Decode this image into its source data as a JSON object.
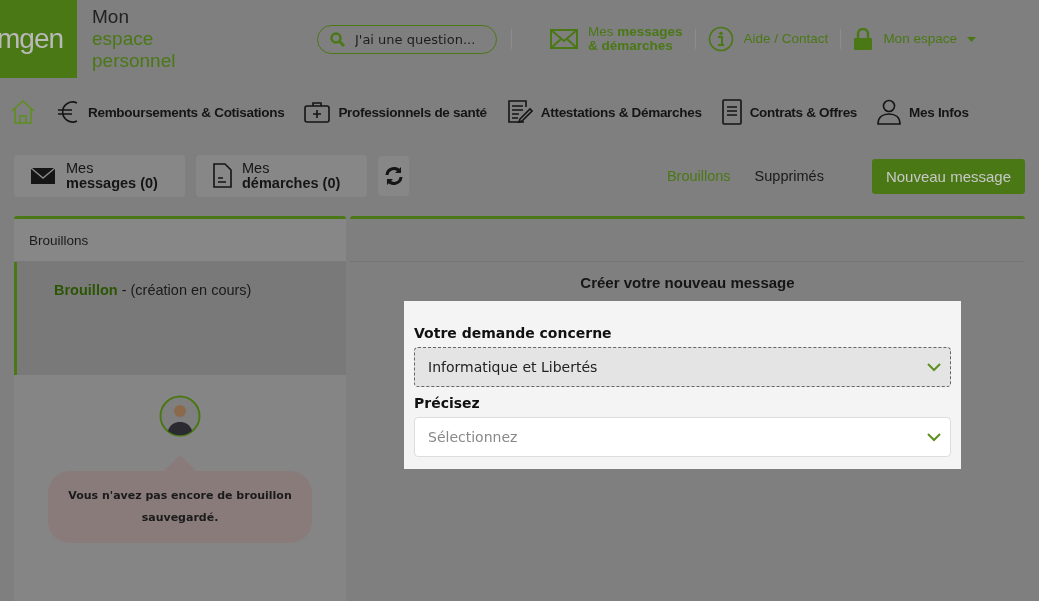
{
  "header": {
    "logo": "mgen",
    "title_lines": [
      "Mon",
      "espace",
      "personnel"
    ],
    "search": {
      "placeholder": "J'ai une question..."
    },
    "links": [
      {
        "kind": "mail",
        "lines": [
          "Mes **messages**",
          "**& démarches**"
        ]
      },
      {
        "kind": "info",
        "lines": [
          "Aide / Contact"
        ]
      },
      {
        "kind": "lock",
        "lines": [
          "Mon espace"
        ],
        "dropdown": true
      }
    ]
  },
  "nav": [
    {
      "kind": "home"
    },
    {
      "kind": "euro",
      "label": "Remboursements & Cotisations"
    },
    {
      "kind": "medkit",
      "label": "Professionnels de santé"
    },
    {
      "kind": "edit",
      "label": "Attestations & Démarches"
    },
    {
      "kind": "doc",
      "label": "Contrats & Offres"
    },
    {
      "kind": "user",
      "label": "Mes Infos"
    }
  ],
  "toolbar": {
    "boxes": [
      {
        "kind": "mail",
        "line1": "Mes",
        "line2": "messages (0)"
      },
      {
        "kind": "file",
        "line1": "Mes",
        "line2": "démarches (0)"
      }
    ],
    "filters": [
      {
        "label": "Brouillons",
        "selected": true
      },
      {
        "label": "Supprimés",
        "selected": false
      }
    ],
    "new_button": "Nouveau message"
  },
  "drafts_panel": {
    "title": "Brouillons",
    "items": [
      {
        "title": "Brouillon",
        "suffix": "- (création en cours)",
        "selected": true
      }
    ],
    "empty_message": "Vous n'avez pas encore de brouillon sauvegardé."
  },
  "compose": {
    "title": "Créer votre nouveau message",
    "fields": [
      {
        "label": "Votre demande concerne",
        "value": "Informatique et Libertés",
        "focused": true
      },
      {
        "label": "Précisez",
        "placeholder": "Sélectionnez",
        "focused": false
      }
    ]
  }
}
